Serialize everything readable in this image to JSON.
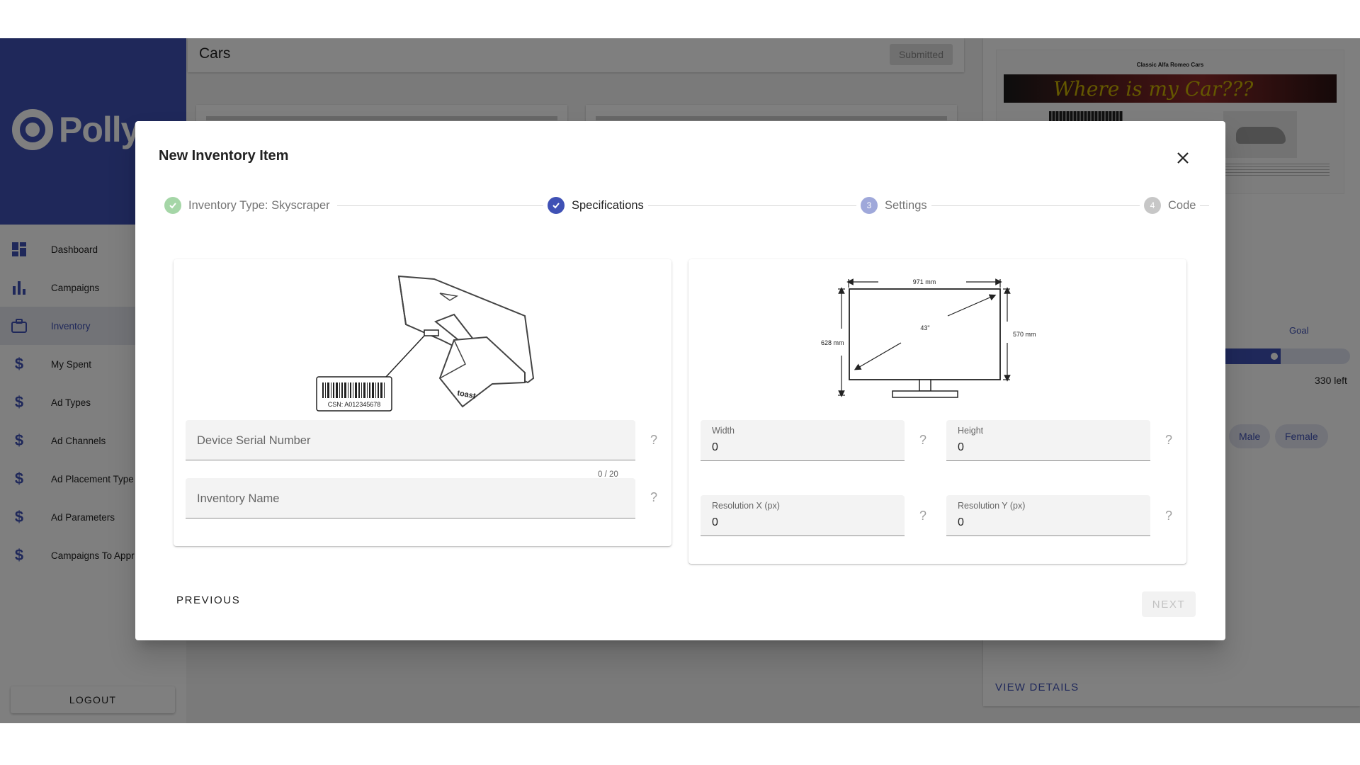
{
  "app": {
    "brand_name": "Pollysp",
    "logout_label": "LOGOUT"
  },
  "sidebar": {
    "items": [
      {
        "label": "Dashboard",
        "icon": "dashboard-icon"
      },
      {
        "label": "Campaigns",
        "icon": "bar-chart-icon"
      },
      {
        "label": "Inventory",
        "icon": "briefcase-icon",
        "active": true
      },
      {
        "label": "My Spent",
        "icon": "dollar-icon"
      },
      {
        "label": "Ad Types",
        "icon": "dollar-icon"
      },
      {
        "label": "Ad Channels",
        "icon": "dollar-icon"
      },
      {
        "label": "Ad Placement Type",
        "icon": "dollar-icon"
      },
      {
        "label": "Ad Parameters",
        "icon": "dollar-icon"
      },
      {
        "label": "Campaigns To Appr",
        "icon": "dollar-icon"
      }
    ]
  },
  "campaign": {
    "title": "Cars",
    "status": "Submitted",
    "preview_title": "Classic Alfa Romeo Cars",
    "preview_banner": "Where is my Car???",
    "goal_label": "Goal",
    "goal_progress": 0.81,
    "remaining": "330 left",
    "genders": [
      "Male",
      "Female"
    ],
    "view_details": "VIEW DETAILS"
  },
  "dialog": {
    "title": "New Inventory Item",
    "steps": [
      {
        "label": "Inventory Type: Skyscraper",
        "state": "done",
        "marker": ""
      },
      {
        "label": "Specifications",
        "state": "active",
        "marker": ""
      },
      {
        "label": "Settings",
        "state": "pending",
        "marker": "3"
      },
      {
        "label": "Code",
        "state": "pending",
        "marker": "4"
      }
    ],
    "device_image": {
      "barcode_text": "CSN: A012345678",
      "brand_text": "toast"
    },
    "screen_image": {
      "width_label": "971 mm",
      "height_outer_label": "628 mm",
      "height_inner_label": "570 mm",
      "diagonal_label": "43\""
    },
    "fields": {
      "serial": {
        "placeholder": "Device Serial Number",
        "counter": "0 / 20",
        "help": "?"
      },
      "name": {
        "placeholder": "Inventory Name",
        "help": "?"
      },
      "width": {
        "label": "Width",
        "value": "0",
        "help": "?"
      },
      "height": {
        "label": "Height",
        "value": "0",
        "help": "?"
      },
      "res_x": {
        "label": "Resolution X (px)",
        "value": "0",
        "help": "?"
      },
      "res_y": {
        "label": "Resolution Y (px)",
        "value": "0",
        "help": "?"
      }
    },
    "previous_label": "PREVIOUS",
    "next_label": "NEXT"
  },
  "colors": {
    "primary": "#3f51b5",
    "step_done": "#4caf50",
    "step_pending": "#9e9e9e"
  }
}
